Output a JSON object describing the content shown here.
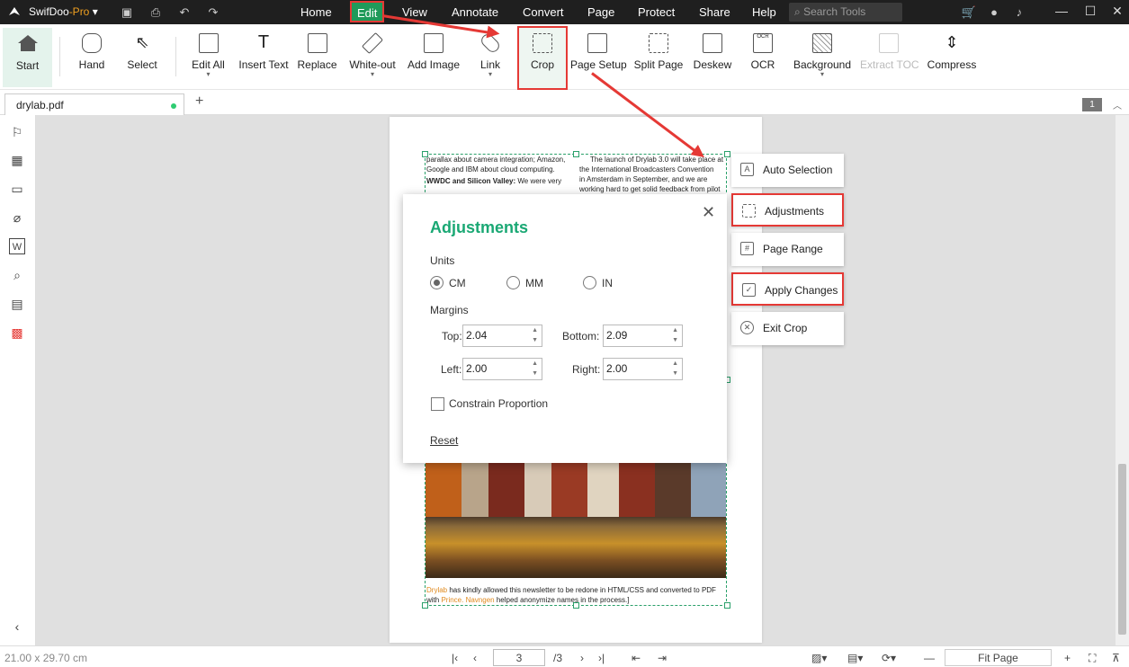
{
  "app": {
    "name": "SwifDoo",
    "name_suffix": "-Pro"
  },
  "menu": [
    "Home",
    "Edit",
    "View",
    "Annotate",
    "Convert",
    "Page",
    "Protect",
    "Share",
    "Help"
  ],
  "search": {
    "placeholder": "Search Tools"
  },
  "ribbon": {
    "start": "Start",
    "hand": "Hand",
    "select": "Select",
    "edit_all": "Edit All",
    "insert_text": "Insert Text",
    "replace": "Replace",
    "white_out": "White-out",
    "add_image": "Add Image",
    "link": "Link",
    "crop": "Crop",
    "page_setup": "Page Setup",
    "split_page": "Split Page",
    "deskew": "Deskew",
    "ocr": "OCR",
    "background": "Background",
    "extract_toc": "Extract TOC",
    "compress": "Compress"
  },
  "tab": {
    "name": "drylab.pdf",
    "add": "+",
    "page_badge": "1"
  },
  "document": {
    "col1_line1": "parallax about camera integration; Amazon,",
    "col1_line2": "Google and IBM about cloud computing.",
    "col1_head": "WWDC and Silicon Valley:",
    "col1_line3": "We were very",
    "col2_line1": "The launch of Drylab 3.0 will take place at",
    "col2_line2": "the International Broadcasters Convention",
    "col2_line3": "in Amsterdam in September, and we are",
    "col2_line4": "working hard to get solid feedback from pilot",
    "footer_brand": "Drylab",
    "footer_line1": " has kindly allowed this newsletter to be redone in HTML/CSS and converted to PDF",
    "footer_with": "with ",
    "footer_name": "Prince. Navngen",
    "footer_line2": " helped anonymize names in the process.]"
  },
  "crop_panel": [
    "Auto Selection",
    "Adjustments",
    "Page Range",
    "Apply Changes",
    "Exit Crop"
  ],
  "dialog": {
    "title": "Adjustments",
    "units_label": "Units",
    "units": [
      "CM",
      "MM",
      "IN"
    ],
    "selected_unit": "CM",
    "margins_label": "Margins",
    "top_label": "Top:",
    "top": "2.04",
    "bottom_label": "Bottom:",
    "bottom": "2.09",
    "left_label": "Left:",
    "left": "2.00",
    "right_label": "Right:",
    "right": "2.00",
    "constrain": "Constrain Proportion",
    "reset": "Reset"
  },
  "status": {
    "page_size": "21.00 x 29.70 cm",
    "current_page": "3",
    "total_pages": "/3",
    "zoom": "Fit Page"
  },
  "colors": {
    "accent": "#1aa874",
    "highlight": "#e53935",
    "titlebar": "#1f1f1f"
  }
}
